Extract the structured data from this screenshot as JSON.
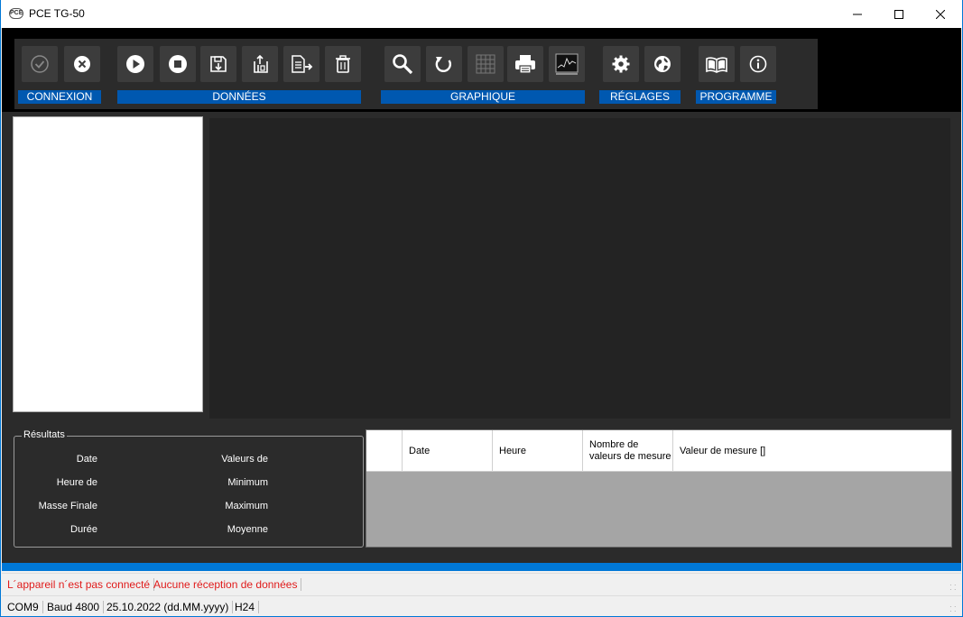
{
  "window": {
    "title": "PCE TG-50",
    "icon_text": "PCE"
  },
  "toolbar": {
    "groups": {
      "connexion": "CONNEXION",
      "donnees": "DONNÉES",
      "graphique": "GRAPHIQUE",
      "reglages": "RÉGLAGES",
      "programme": "PROGRAMME"
    },
    "icons": {
      "connect": "check-circle-icon",
      "disconnect": "x-circle-icon",
      "start": "play-icon",
      "stop": "stop-icon",
      "save": "save-icon",
      "load": "open-icon",
      "export": "export-icon",
      "delete": "trash-icon",
      "zoom": "magnifier-icon",
      "reset": "refresh-icon",
      "grid": "grid-icon",
      "print": "printer-icon",
      "chart": "chart-icon",
      "settings": "gear-icon",
      "language": "globe-icon",
      "manual": "book-icon",
      "about": "info-icon"
    }
  },
  "results": {
    "legend": "Résultats",
    "date": "Date",
    "heure_de": "Heure de",
    "masse_finale": "Masse Finale",
    "duree": "Durée",
    "valeurs_de": "Valeurs de",
    "minimum": "Minimum",
    "maximum": "Maximum",
    "moyenne": "Moyenne"
  },
  "table": {
    "columns": [
      "",
      "Date",
      "Heure",
      "Nombre de valeurs de mesure",
      "Valeur de mesure []"
    ]
  },
  "status": {
    "not_connected": "L´appareil n´est pas connecté",
    "no_data": "Aucune réception de données",
    "port": "COM9",
    "baud": "Baud 4800",
    "date_format": "25.10.2022 (dd.MM.yyyy)",
    "time_format": "H24"
  },
  "colors": {
    "accent": "#0078d7",
    "group_label": "#0058b0",
    "status_error": "#e01b1b",
    "panel": "#2b2b2b"
  }
}
